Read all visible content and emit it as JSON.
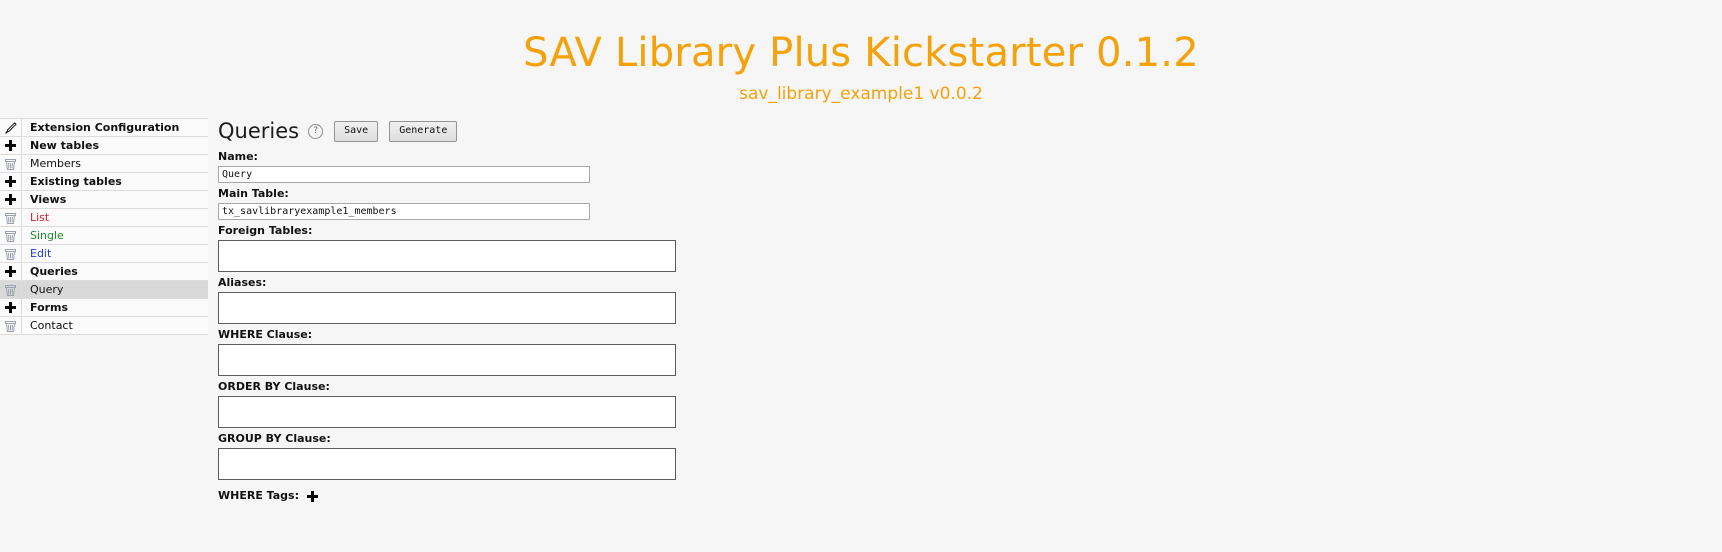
{
  "header": {
    "title": "SAV Library Plus Kickstarter 0.1.2",
    "subtitle": "sav_library_example1 v0.0.2",
    "accent_color": "#f5a20a"
  },
  "sidebar": {
    "items": [
      {
        "label": "Extension Configuration",
        "icon": "pencil-icon",
        "bold": true,
        "color": "default",
        "selected": false
      },
      {
        "label": "New tables",
        "icon": "plus-icon",
        "bold": true,
        "color": "default",
        "selected": false
      },
      {
        "label": "Members",
        "icon": "trash-icon",
        "bold": false,
        "color": "default",
        "selected": false
      },
      {
        "label": "Existing tables",
        "icon": "plus-icon",
        "bold": true,
        "color": "default",
        "selected": false
      },
      {
        "label": "Views",
        "icon": "plus-icon",
        "bold": true,
        "color": "default",
        "selected": false
      },
      {
        "label": "List",
        "icon": "trash-icon",
        "bold": false,
        "color": "red",
        "selected": false
      },
      {
        "label": "Single",
        "icon": "trash-icon",
        "bold": false,
        "color": "green",
        "selected": false
      },
      {
        "label": "Edit",
        "icon": "trash-icon",
        "bold": false,
        "color": "blue",
        "selected": false
      },
      {
        "label": "Queries",
        "icon": "plus-icon",
        "bold": true,
        "color": "default",
        "selected": false
      },
      {
        "label": "Query",
        "icon": "trash-icon",
        "bold": false,
        "color": "default",
        "selected": true
      },
      {
        "label": "Forms",
        "icon": "plus-icon",
        "bold": true,
        "color": "default",
        "selected": false
      },
      {
        "label": "Contact",
        "icon": "trash-icon",
        "bold": false,
        "color": "default",
        "selected": false
      }
    ]
  },
  "main": {
    "page_title": "Queries",
    "help_icon_glyph": "?",
    "buttons": {
      "save": "Save",
      "generate": "Generate"
    },
    "fields": [
      {
        "label": "Name:",
        "value": "Query",
        "type": "text"
      },
      {
        "label": "Main Table:",
        "value": "tx_savlibraryexample1_members",
        "type": "text"
      },
      {
        "label": "Foreign Tables:",
        "value": "",
        "type": "textarea"
      },
      {
        "label": "Aliases:",
        "value": "",
        "type": "textarea"
      },
      {
        "label": "WHERE Clause:",
        "value": "",
        "type": "textarea"
      },
      {
        "label": "ORDER BY Clause:",
        "value": "",
        "type": "textarea"
      },
      {
        "label": "GROUP BY Clause:",
        "value": "",
        "type": "textarea"
      }
    ],
    "where_tags": {
      "label": "WHERE Tags:",
      "add_icon": "plus-icon"
    }
  }
}
